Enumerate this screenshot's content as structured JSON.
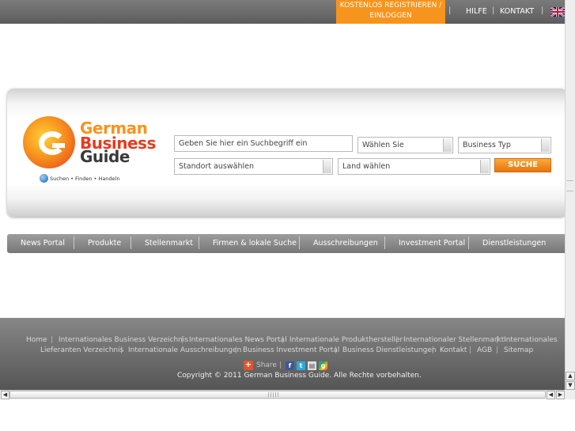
{
  "topbar": {
    "register_line1": "KOSTENLOS REGISTRIEREN /",
    "register_line2": "EINLOGGEN",
    "help": "HILFE",
    "contact": "KONTAKT",
    "separator": "|",
    "language_icon": "uk-flag-icon"
  },
  "logo": {
    "word1": "German",
    "word2": "Business",
    "word3": "Guide",
    "tagline": "Suchen • Finden • Handeln",
    "colors": {
      "orange": "#f7941d",
      "red": "#e63b1f",
      "dark": "#3a3a3a"
    }
  },
  "search": {
    "query_value": "Geben Sie hier ein Suchbegriff ein",
    "select1_value": "Wählen Sie",
    "select2_value": "Business Typ",
    "location_value": "Standort auswählen",
    "country_value": "Land wählen",
    "button_label": "SUCHE"
  },
  "mainnav": {
    "items": [
      {
        "label": "News Portal"
      },
      {
        "label": "Produkte"
      },
      {
        "label": "Stellenmarkt"
      },
      {
        "label": "Firmen & lokale Suche"
      },
      {
        "label": "Ausschreibungen"
      },
      {
        "label": "Investment Portal"
      },
      {
        "label": "Dienstleistungen"
      }
    ]
  },
  "footer": {
    "separator": "|",
    "links": [
      {
        "label": "Home"
      },
      {
        "label": "Internationales Business Verzeichnis"
      },
      {
        "label": "Internationales News Portal"
      },
      {
        "label": "Internationale Produkthersteller"
      },
      {
        "label": "Internationaler Stellenmarkt"
      },
      {
        "label": "Internationales"
      },
      {
        "label": "Lieferanten Verzeichnis"
      },
      {
        "label": "Internationale Ausschreibungen"
      },
      {
        "label": "Business Investment Portal"
      },
      {
        "label": "Business Dienstleistungen"
      },
      {
        "label": "Kontakt"
      },
      {
        "label": "AGB"
      },
      {
        "label": "Sitemap"
      }
    ],
    "share_label": "Share",
    "share_icons": [
      "share-plus-icon",
      "facebook-icon",
      "twitter-icon",
      "print-icon",
      "google-icon"
    ],
    "copyright": "Copyright © 2011 German Business Guide. Alle Rechte vorbehalten."
  },
  "scrollbars": {
    "up_arrow": "▲",
    "down_arrow": "▼",
    "left_arrow": "◀",
    "right_arrow": "▶"
  }
}
